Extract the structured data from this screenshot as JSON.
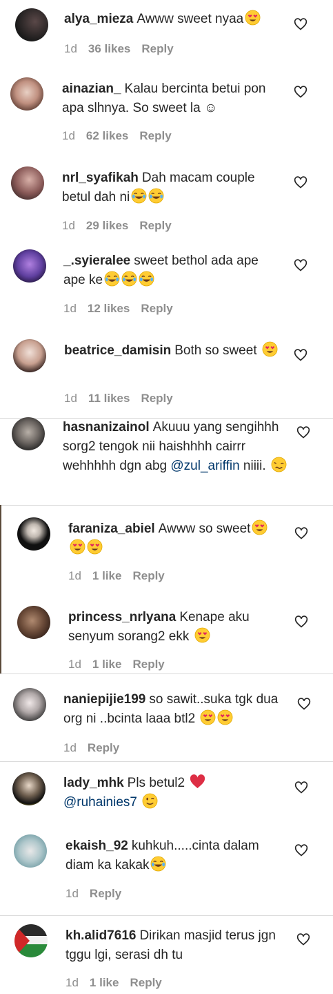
{
  "comments": [
    {
      "username": "alya_mieza",
      "text": "Awww sweet nyaa",
      "emojis": [
        "heart-eyes"
      ],
      "time": "1d",
      "likes": "36 likes",
      "reply": "Reply",
      "avatar_colors": [
        "#1a1a1a",
        "#4a3b3b"
      ]
    },
    {
      "username": "ainazian_",
      "text": "Kalau bercinta betui pon apa slhnya. So sweet la ☺",
      "emojis": [],
      "time": "1d",
      "likes": "62 likes",
      "reply": "Reply",
      "avatar_colors": [
        "#d8c9c0",
        "#8a5a48"
      ]
    },
    {
      "username": "nrl_syafikah",
      "text": "Dah macam couple betul dah ni",
      "emojis": [
        "joy",
        "joy"
      ],
      "time": "1d",
      "likes": "29 likes",
      "reply": "Reply",
      "avatar_colors": [
        "#c8a8a0",
        "#5a4040"
      ]
    },
    {
      "username": "_.syieralee",
      "text": "sweet bethol ada ape ape ke",
      "emojis": [
        "joy",
        "joy",
        "joy"
      ],
      "time": "1d",
      "likes": "12 likes",
      "reply": "Reply",
      "avatar_colors": [
        "#7a5ab0",
        "#2a1a4a"
      ]
    },
    {
      "username": "beatrice_damisin",
      "text": "Both so sweet",
      "emojis": [
        "heart-eyes"
      ],
      "time": "1d",
      "likes": "11 likes",
      "reply": "Reply",
      "avatar_colors": [
        "#f0e0d8",
        "#6a3a30"
      ]
    },
    {
      "username": "hasnanizainol",
      "text_parts": [
        "Akuuu yang sengihhh sorg2 tengok nii haishhhh cairrr wehhhhh dgn abg ",
        "@zul_ariffin",
        " niiii."
      ],
      "emojis": [
        "woozy"
      ],
      "time": "",
      "likes": "",
      "reply": "",
      "avatar_colors": [
        "#b0a8a0",
        "#3a3a3a"
      ]
    },
    {
      "username": "faraniza_abiel",
      "text": "Awww so sweet",
      "emojis": [
        "heart-eyes",
        "heart-eyes",
        "heart-eyes"
      ],
      "time": "1d",
      "likes": "1 like",
      "reply": "Reply",
      "avatar_colors": [
        "#202020",
        "#e8e0d8"
      ]
    },
    {
      "username": "princess_nrlyana",
      "text": "Kenape aku senyum sorang2 ekk",
      "emojis": [
        "heart-eyes"
      ],
      "time": "1d",
      "likes": "1 like",
      "reply": "Reply",
      "avatar_colors": [
        "#8a6a50",
        "#3a2a20"
      ]
    },
    {
      "username": "naniepijie199",
      "text": "so sawit..suka tgk dua org ni ..bcinta laaa btl2",
      "emojis": [
        "heart-eyes",
        "heart-eyes"
      ],
      "time": "1d",
      "likes": "",
      "reply": "Reply",
      "avatar_colors": [
        "#e8e0e0",
        "#404040"
      ]
    },
    {
      "username": "lady_mhk",
      "text_parts": [
        "Pls betul2 ",
        "@ruhainies7"
      ],
      "emojis": [
        "red-heart",
        "wink"
      ],
      "time": "",
      "likes": "",
      "reply": "",
      "avatar_colors": [
        "#c8b030",
        "#303030"
      ]
    },
    {
      "username": "ekaish_92",
      "text": "kuhkuh.....cinta dalam diam ka kakak",
      "emojis": [
        "joy"
      ],
      "time": "1d",
      "likes": "",
      "reply": "Reply",
      "avatar_colors": [
        "#90b8c0",
        "#e0e0e0"
      ]
    },
    {
      "username": "kh.alid7616",
      "text": "Dirikan masjid terus jgn tggu lgi, serasi dh tu",
      "emojis": [],
      "time": "1d",
      "likes": "1 like",
      "reply": "Reply",
      "avatar_colors": [
        "#c03030",
        "#303030"
      ]
    }
  ],
  "colors": {
    "username": "#262626",
    "text": "#262626",
    "meta": "#8e8e8e",
    "mention": "#00376b",
    "divider": "#dbdbdb"
  }
}
